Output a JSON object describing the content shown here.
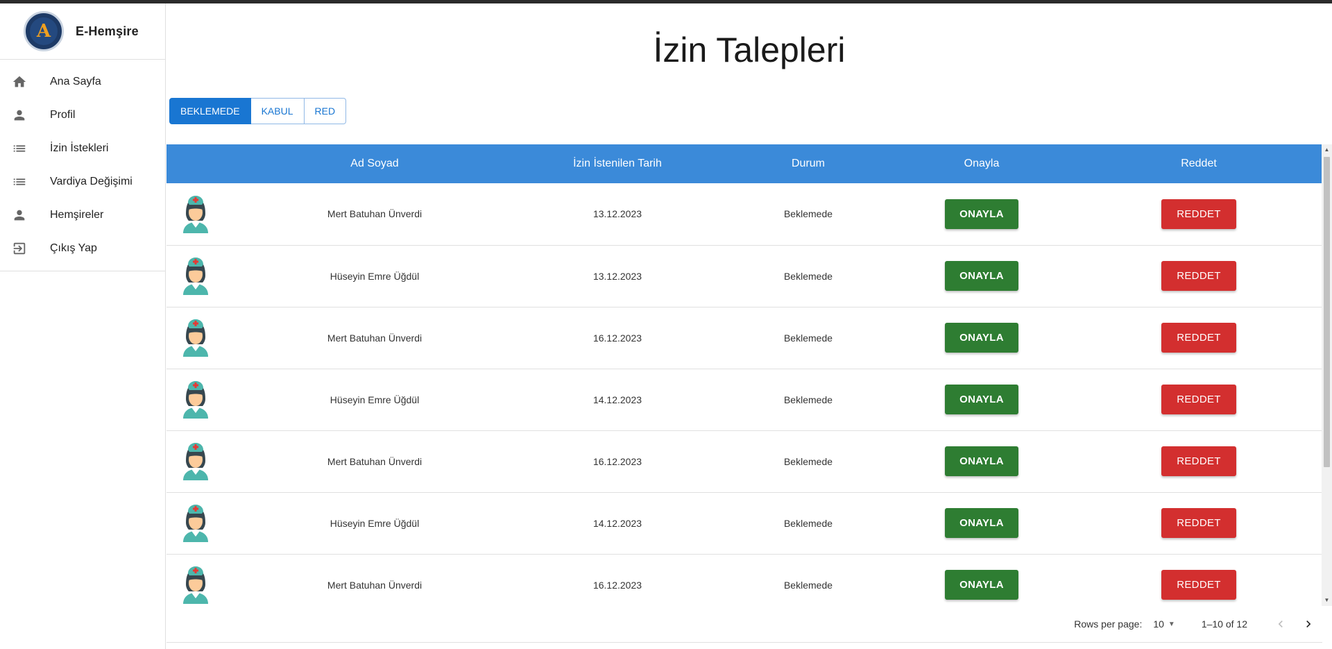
{
  "app": {
    "name": "E-Hemşire"
  },
  "sidebar": {
    "items": [
      {
        "label": "Ana Sayfa",
        "icon": "home-icon"
      },
      {
        "label": "Profil",
        "icon": "person-icon"
      },
      {
        "label": "İzin İstekleri",
        "icon": "list-icon"
      },
      {
        "label": "Vardiya Değişimi",
        "icon": "list-icon"
      },
      {
        "label": "Hemşireler",
        "icon": "person-icon"
      },
      {
        "label": "Çıkış Yap",
        "icon": "logout-icon"
      }
    ]
  },
  "page": {
    "title": "İzin Talepleri"
  },
  "tabs": [
    {
      "label": "BEKLEMEDE",
      "active": true
    },
    {
      "label": "KABUL",
      "active": false
    },
    {
      "label": "RED",
      "active": false
    }
  ],
  "table": {
    "headers": [
      "",
      "Ad Soyad",
      "İzin İstenilen Tarih",
      "Durum",
      "Onayla",
      "Reddet"
    ],
    "rows": [
      {
        "name": "Mert Batuhan Ünverdi",
        "date": "13.12.2023",
        "status": "Beklemede",
        "approve": "ONAYLA",
        "reject": "REDDET"
      },
      {
        "name": "Hüseyin Emre Üğdül",
        "date": "13.12.2023",
        "status": "Beklemede",
        "approve": "ONAYLA",
        "reject": "REDDET"
      },
      {
        "name": "Mert Batuhan Ünverdi",
        "date": "16.12.2023",
        "status": "Beklemede",
        "approve": "ONAYLA",
        "reject": "REDDET"
      },
      {
        "name": "Hüseyin Emre Üğdül",
        "date": "14.12.2023",
        "status": "Beklemede",
        "approve": "ONAYLA",
        "reject": "REDDET"
      },
      {
        "name": "Mert Batuhan Ünverdi",
        "date": "16.12.2023",
        "status": "Beklemede",
        "approve": "ONAYLA",
        "reject": "REDDET"
      },
      {
        "name": "Hüseyin Emre Üğdül",
        "date": "14.12.2023",
        "status": "Beklemede",
        "approve": "ONAYLA",
        "reject": "REDDET"
      },
      {
        "name": "Mert Batuhan Ünverdi",
        "date": "16.12.2023",
        "status": "Beklemede",
        "approve": "ONAYLA",
        "reject": "REDDET"
      }
    ]
  },
  "pagination": {
    "rows_per_page_label": "Rows per page:",
    "rows_per_page": "10",
    "range": "1–10 of 12"
  },
  "colors": {
    "header_bg": "#3b8ad9",
    "primary": "#1976d2",
    "approve": "#2e7d32",
    "reject": "#d32f2f"
  }
}
